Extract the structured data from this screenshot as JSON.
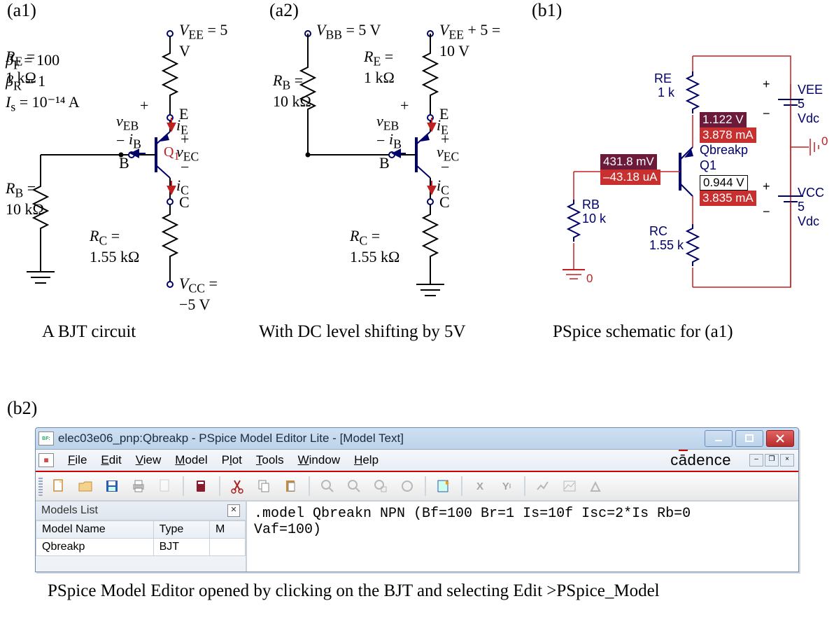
{
  "panels": {
    "a1": "(a1)",
    "a2": "(a2)",
    "b1": "(b1)",
    "b2": "(b2)"
  },
  "captions": {
    "a1": "A BJT circuit",
    "a2": "With DC level shifting by 5V",
    "b1": "PSpice schematic for (a1)",
    "b2": "PSpice Model Editor opened by clicking on the BJT and selecting Edit >PSpice_Model"
  },
  "a1": {
    "betaF": "β",
    "betaF_sub": "F",
    "betaF_rhs": " = 100",
    "betaR": "β",
    "betaR_sub": "R",
    "betaR_rhs": " = 1",
    "Is": "I",
    "Is_sub": "s",
    "Is_rhs": " = 10⁻¹⁴ A",
    "RE": "R",
    "RE_sub": "E",
    "RE_rhs": " =",
    "RE_val": "1 kΩ",
    "RB": "R",
    "RB_sub": "B",
    "RB_rhs": " =",
    "RB_val": "10 kΩ",
    "RC": "R",
    "RC_sub": "C",
    "RC_rhs": " =",
    "RC_val": "1.55 kΩ",
    "VEE": "V",
    "VEE_sub": "EE",
    "VEE_rhs": " = 5 V",
    "VCC": "V",
    "VCC_sub": "CC",
    "VCC_rhs": " = −5 V",
    "vEB": "v",
    "vEB_sub": "EB",
    "vEC": "v",
    "vEC_sub": "EC",
    "iE": "i",
    "iE_sub": "E",
    "iB": "i",
    "iB_sub": "B",
    "iC": "i",
    "iC_sub": "C",
    "Q1": "Q",
    "Q1_sub": "1",
    "B": "B",
    "E": "E",
    "C": "C",
    "plus": "+",
    "minus": "−"
  },
  "a2": {
    "VBB": "V",
    "VBB_sub": "BB",
    "VBB_rhs": " = 5 V",
    "VEE": "V",
    "VEE_sub": "EE",
    "VEE_rhs": " + 5 = 10 V"
  },
  "b1": {
    "RE": "RE",
    "RE_val": "1 k",
    "RB": "RB",
    "RB_val": "10 k",
    "RC": "RC",
    "RC_val": "1.55 k",
    "VEE": "VEE",
    "VEE_val": "5 Vdc",
    "VCC": "VCC",
    "VCC_val": "5 Vdc",
    "Q": "Qbreakp",
    "Q1": "Q1",
    "vE": "1.122 V",
    "iE": "3.878 mA",
    "vB": "431.8 mV",
    "iB": "–43.18 uA",
    "vC": "0.944 V",
    "iC": "3.835 mA",
    "gnd0a": "0",
    "gnd0b": "0"
  },
  "b2": {
    "title": "elec03e06_pnp:Qbreakp - PSpice Model Editor Lite  - [Model Text]",
    "menu": [
      "File",
      "Edit",
      "View",
      "Model",
      "Plot",
      "Tools",
      "Window",
      "Help"
    ],
    "brand": "cādence",
    "models_list_label": "Models List",
    "cols": [
      "Model Name",
      "Type",
      "M"
    ],
    "row": [
      "Qbreakp",
      "BJT",
      ""
    ],
    "editor": ".model Qbreakn NPN (Bf=100 Br=1 Is=10f Isc=2*Is Rb=0\nVaf=100)"
  }
}
